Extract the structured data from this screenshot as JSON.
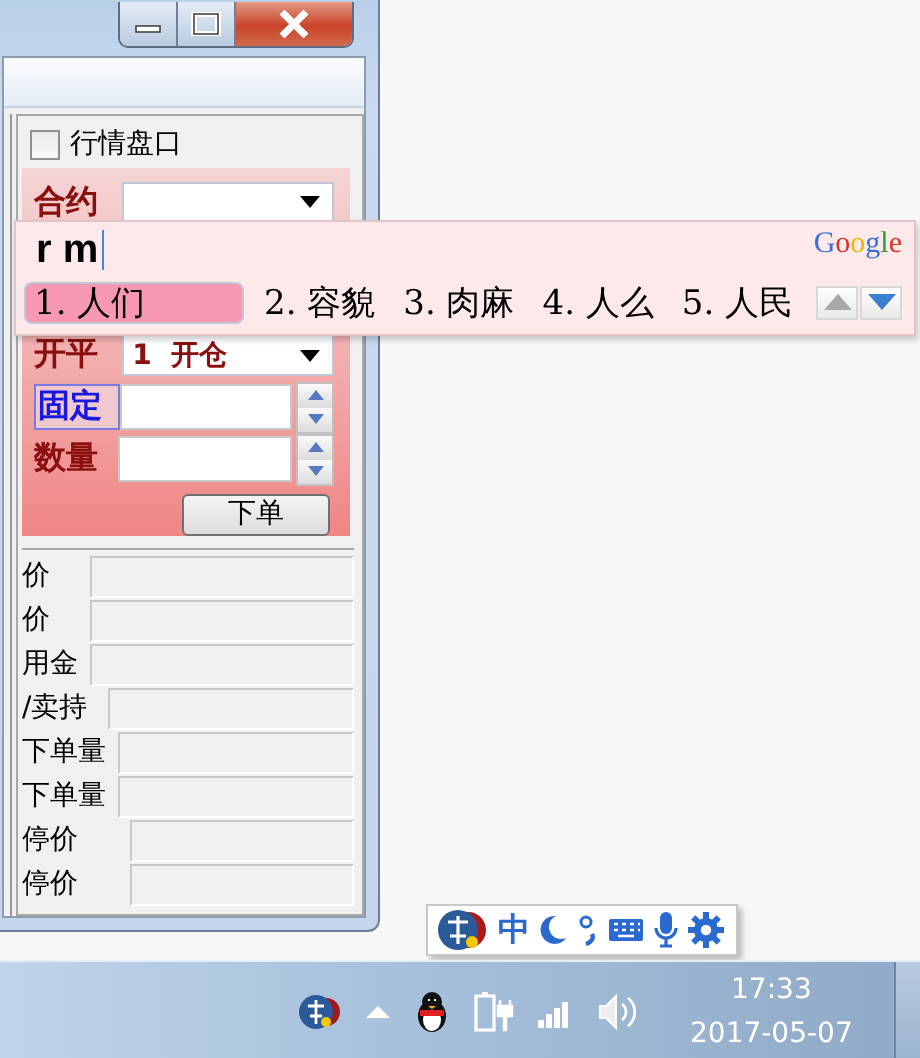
{
  "order_panel": {
    "quote_checkbox": {
      "label": "行情盘口",
      "checked": false
    },
    "fields": [
      {
        "kind": "select",
        "label": "合约",
        "focused": false
      },
      {
        "kind": "gap"
      },
      {
        "kind": "select",
        "label": "开平",
        "value": "1  开仓",
        "focused": false
      },
      {
        "kind": "spinner",
        "label": "固定",
        "focused": true
      },
      {
        "kind": "spinner",
        "label": "数量",
        "focused": false
      }
    ],
    "submit_button": "下单"
  },
  "info_fields": [
    {
      "label": "价"
    },
    {
      "label": "价"
    },
    {
      "label": "用金"
    },
    {
      "label": "/卖持"
    },
    {
      "label": "下单量"
    },
    {
      "label": "下单量"
    },
    {
      "label": "停价"
    },
    {
      "label": "停价"
    }
  ],
  "ime_popup": {
    "input": "r m",
    "brand": "Google",
    "candidates": [
      {
        "text": "1. 人们",
        "selected": true
      },
      {
        "text": "2. 容貌",
        "selected": false
      },
      {
        "text": "3. 肉麻",
        "selected": false
      },
      {
        "text": "4. 人么",
        "selected": false
      },
      {
        "text": "5. 人民",
        "selected": false
      }
    ]
  },
  "ime_toolbar": {
    "mode": "中"
  },
  "taskbar": {
    "time": "17:33",
    "date": "2017-05-07"
  }
}
